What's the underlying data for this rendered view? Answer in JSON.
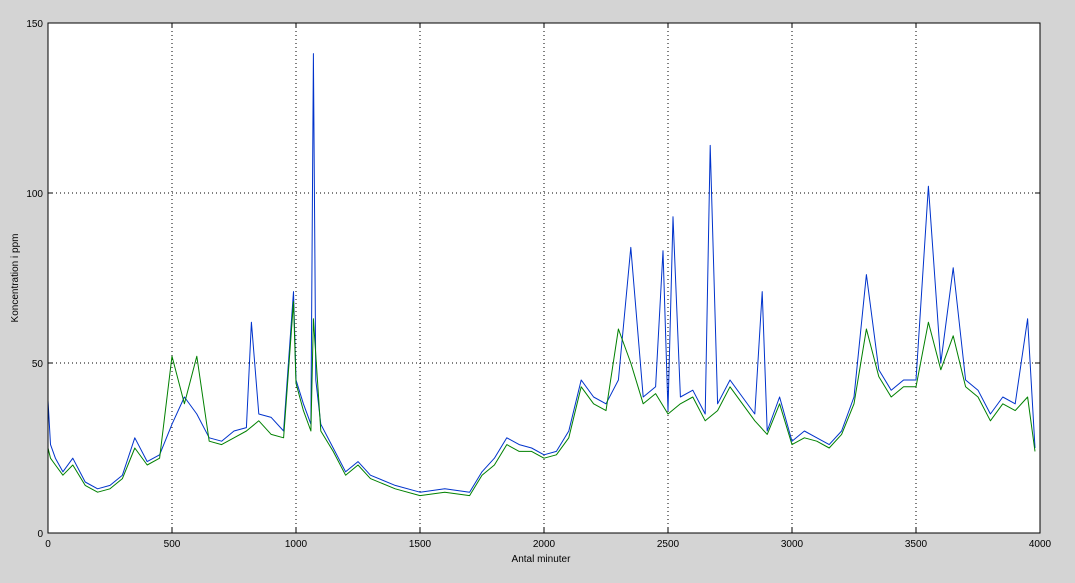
{
  "chart_data": {
    "type": "line",
    "title": "",
    "xlabel": "Antal minuter",
    "ylabel": "Koncentration i ppm",
    "xlim": [
      0,
      4000
    ],
    "ylim": [
      0,
      150
    ],
    "xticks": [
      "0",
      "500",
      "1000",
      "1500",
      "2000",
      "2500",
      "3000",
      "3500",
      "4000"
    ],
    "yticks": [
      "0",
      "50",
      "100",
      "150"
    ],
    "grid": true,
    "legend": "none",
    "colors": {
      "figure_bg": "#d4d4d4",
      "axes_bg": "#ffffff",
      "series_a": "#0033cc",
      "series_b": "#008000",
      "grid": "#000000"
    },
    "series": [
      {
        "color": "#0033cc",
        "x": [
          0,
          10,
          30,
          60,
          100,
          150,
          200,
          250,
          300,
          350,
          400,
          450,
          500,
          550,
          600,
          650,
          700,
          750,
          800,
          820,
          850,
          900,
          950,
          990,
          1000,
          1030,
          1060,
          1070,
          1080,
          1100,
          1150,
          1200,
          1250,
          1300,
          1400,
          1500,
          1600,
          1700,
          1750,
          1800,
          1850,
          1900,
          1950,
          2000,
          2050,
          2100,
          2150,
          2200,
          2250,
          2300,
          2350,
          2400,
          2450,
          2480,
          2500,
          2520,
          2550,
          2600,
          2650,
          2670,
          2700,
          2750,
          2800,
          2850,
          2880,
          2900,
          2950,
          3000,
          3050,
          3100,
          3150,
          3200,
          3250,
          3300,
          3350,
          3400,
          3450,
          3500,
          3550,
          3600,
          3650,
          3700,
          3750,
          3800,
          3850,
          3900,
          3950,
          3980
        ],
        "y": [
          39,
          26,
          22,
          18,
          22,
          15,
          13,
          14,
          17,
          28,
          21,
          23,
          32,
          40,
          35,
          28,
          27,
          30,
          31,
          62,
          35,
          34,
          30,
          71,
          45,
          38,
          32,
          141,
          45,
          32,
          25,
          18,
          21,
          17,
          14,
          12,
          13,
          12,
          18,
          22,
          28,
          26,
          25,
          23,
          24,
          30,
          45,
          40,
          38,
          45,
          84,
          40,
          43,
          83,
          36,
          93,
          40,
          42,
          35,
          114,
          38,
          45,
          40,
          35,
          71,
          30,
          40,
          27,
          30,
          28,
          26,
          30,
          40,
          76,
          48,
          42,
          45,
          45,
          102,
          50,
          78,
          45,
          42,
          35,
          40,
          38,
          63,
          25
        ]
      },
      {
        "color": "#008000",
        "x": [
          0,
          10,
          30,
          60,
          100,
          150,
          200,
          250,
          300,
          350,
          400,
          450,
          500,
          550,
          600,
          650,
          700,
          750,
          800,
          850,
          900,
          950,
          990,
          1000,
          1030,
          1060,
          1070,
          1100,
          1150,
          1200,
          1250,
          1300,
          1400,
          1500,
          1600,
          1700,
          1750,
          1800,
          1850,
          1900,
          1950,
          2000,
          2050,
          2100,
          2150,
          2200,
          2250,
          2300,
          2350,
          2400,
          2450,
          2500,
          2550,
          2600,
          2650,
          2700,
          2750,
          2800,
          2850,
          2900,
          2950,
          3000,
          3050,
          3100,
          3150,
          3200,
          3250,
          3300,
          3350,
          3400,
          3450,
          3500,
          3550,
          3600,
          3650,
          3700,
          3750,
          3800,
          3850,
          3900,
          3950,
          3980
        ],
        "y": [
          25,
          22,
          20,
          17,
          20,
          14,
          12,
          13,
          16,
          25,
          20,
          22,
          52,
          38,
          52,
          27,
          26,
          28,
          30,
          33,
          29,
          28,
          68,
          44,
          36,
          30,
          63,
          30,
          24,
          17,
          20,
          16,
          13,
          11,
          12,
          11,
          17,
          20,
          26,
          24,
          24,
          22,
          23,
          28,
          43,
          38,
          36,
          60,
          50,
          38,
          41,
          35,
          38,
          40,
          33,
          36,
          43,
          38,
          33,
          29,
          38,
          26,
          28,
          27,
          25,
          29,
          38,
          60,
          46,
          40,
          43,
          43,
          62,
          48,
          58,
          43,
          40,
          33,
          38,
          36,
          40,
          24
        ]
      }
    ]
  }
}
